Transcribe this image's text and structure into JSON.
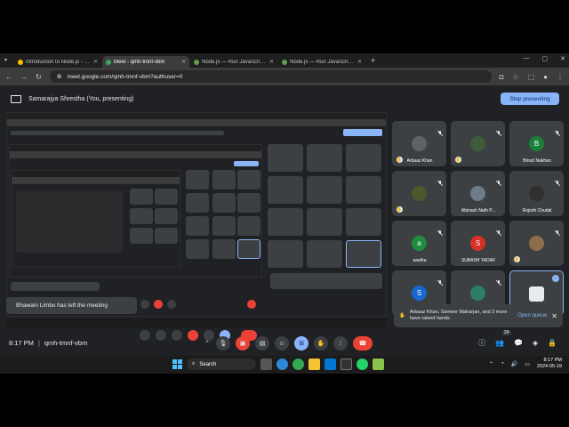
{
  "browser": {
    "tabs": [
      {
        "label": "Introduction to Node.js - Goog",
        "active": false,
        "color": "#fbbc04"
      },
      {
        "label": "Meet - qmh-tmnf-vbm",
        "active": true,
        "color": "#34a853"
      },
      {
        "label": "Node.js — Run JavaScript Ever",
        "active": false,
        "color": "#5fa04e"
      },
      {
        "label": "Node.js — Run JavaScript Ever",
        "active": false,
        "color": "#5fa04e"
      }
    ],
    "new_tab": "+",
    "url": "meet.google.com/qmh-tmnf-vbm?authuser=0"
  },
  "presenting": {
    "text": "Samarajya Shrestha (You, presenting)",
    "stop_label": "Stop presenting"
  },
  "participants": [
    {
      "name": "Arbaaz Khan",
      "avatar": "",
      "avatar_color": "#5f6368",
      "hand": true,
      "self": false
    },
    {
      "name": "",
      "avatar": "",
      "avatar_color": "#3e5b3a",
      "hand": true,
      "self": false
    },
    {
      "name": "Binod Nakhan",
      "avatar": "B",
      "avatar_color": "#188038",
      "hand": false,
      "self": false
    },
    {
      "name": "",
      "avatar": "",
      "avatar_color": "#4a5a2a",
      "hand": true,
      "self": false
    },
    {
      "name": "Abinash Nath P...",
      "avatar": "",
      "avatar_color": "#6d7b8a",
      "hand": false,
      "self": false
    },
    {
      "name": "Rojesh Chudal",
      "avatar": "",
      "avatar_color": "#2f2f2f",
      "hand": false,
      "self": false
    },
    {
      "name": "aastha",
      "avatar": "a",
      "avatar_color": "#1e8e3e",
      "hand": false,
      "self": false
    },
    {
      "name": "SUBASH YADAV",
      "avatar": "S",
      "avatar_color": "#d93025",
      "hand": false,
      "self": false
    },
    {
      "name": "",
      "avatar": "",
      "avatar_color": "#8d6e4a",
      "hand": true,
      "self": false
    },
    {
      "name": "",
      "avatar": "S",
      "avatar_color": "#1967d2",
      "hand": false,
      "self": false
    },
    {
      "name": "",
      "avatar": "",
      "avatar_color": "#2e7d6b",
      "hand": false,
      "self": false
    },
    {
      "name": "",
      "avatar": "",
      "avatar_color": "#e8eaed",
      "hand": false,
      "self": true
    }
  ],
  "notifications": {
    "left_message": "Bhawani Limbu has left the meeting",
    "hands_message": "Arbaaz Khan, Sameer Maharjan, and 3 more have raised hands",
    "open_queue": "Open queue"
  },
  "meeting": {
    "time": "8:17 PM",
    "separator": "|",
    "code": "qmh-tmnf-vbm",
    "raised_count": "24"
  },
  "taskbar": {
    "search_label": "Search",
    "time": "8:17 PM",
    "date": "2024-05-19"
  },
  "colors": {
    "meet_bg": "#202124",
    "tile_bg": "#3c4043",
    "accent": "#8ab4f8",
    "danger": "#ea4335"
  }
}
